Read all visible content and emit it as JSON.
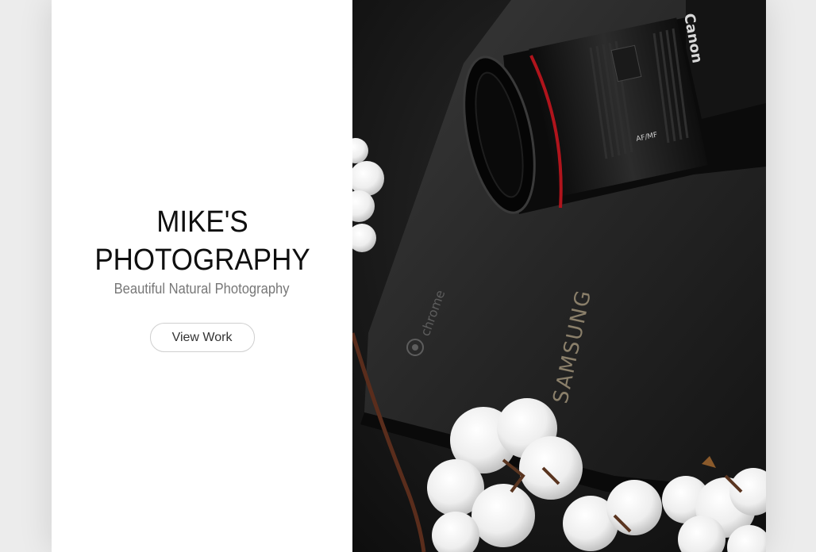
{
  "hero": {
    "title": "MIKE'S\nPHOTOGRAPHY",
    "subtitle": "Beautiful Natural Photography",
    "button_label": "View Work"
  },
  "photo": {
    "laptop_brand": "SAMSUNG",
    "laptop_os": "chrome",
    "camera_brand": "Canon",
    "lens_text": "AF/MF"
  },
  "colors": {
    "page_background": "#ececec",
    "panel_background": "#ffffff",
    "title_color": "#0f0f0f",
    "subtitle_color": "#777777",
    "lens_accent": "#b0141c"
  }
}
